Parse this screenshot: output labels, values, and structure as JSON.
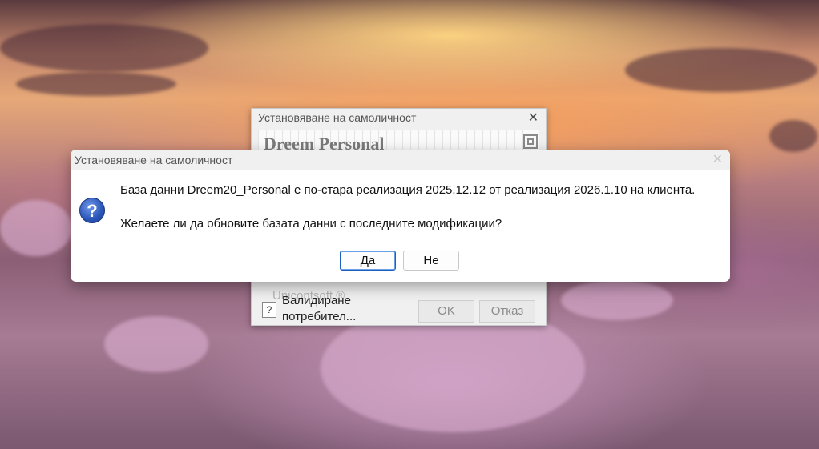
{
  "background_dialog": {
    "title": "Установяване на самоличност",
    "close_glyph": "✕",
    "product": "Dreem Personal",
    "company": "Unicontsoft ®",
    "help_glyph": "?",
    "status": "Валидиране потребител...",
    "ok_label": "OK",
    "cancel_label": "Отказ"
  },
  "message_box": {
    "title": "Установяване на самоличност",
    "close_glyph": "✕",
    "icon": "question-icon",
    "icon_glyph": "?",
    "line1": "База данни Dreem20_Personal е по-стара реализация 2025.12.12 от реализация 2026.1.10 на клиента.",
    "line2": "Желаете ли да обновите базата данни с последните модификации?",
    "yes_label": "Да",
    "no_label": "Не"
  },
  "colors": {
    "accent": "#1f5fbf"
  }
}
